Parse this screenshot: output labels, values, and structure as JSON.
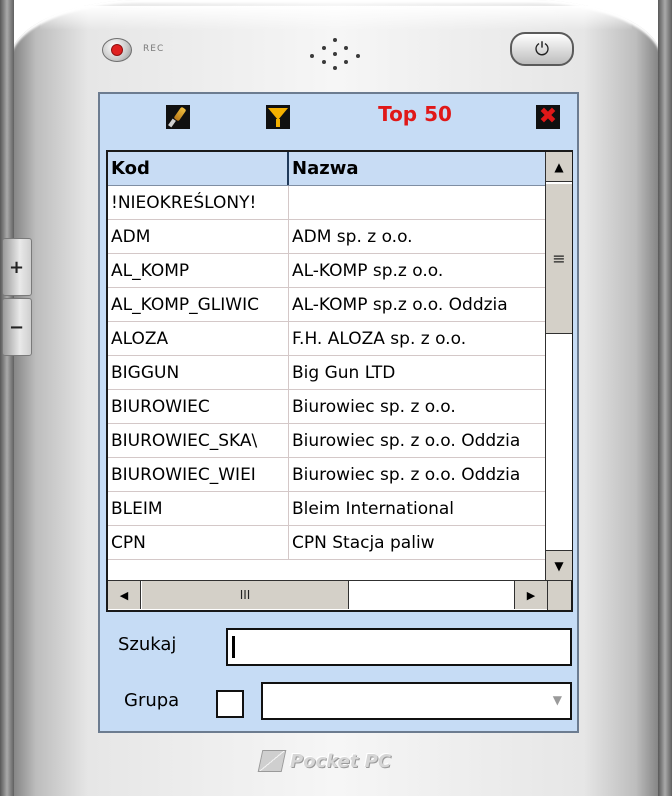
{
  "device": {
    "rec_label": "REC",
    "brand": "Pocket PC",
    "side_plus": "+",
    "side_minus": "−",
    "power_symbol": "⏻"
  },
  "toolbar": {
    "search_icon": "magnifier-icon",
    "filter_icon": "funnel-icon",
    "title": "Top 50",
    "close_icon": "close-icon",
    "close_glyph": "✖"
  },
  "grid": {
    "columns": [
      "Kod",
      "Nazwa"
    ],
    "rows": [
      [
        "!NIEOKREŚLONY!",
        ""
      ],
      [
        "ADM",
        "ADM sp. z o.o."
      ],
      [
        "AL_KOMP",
        "AL-KOMP sp.z o.o."
      ],
      [
        "AL_KOMP_GLIWIC",
        "AL-KOMP sp.z o.o. Oddzia"
      ],
      [
        "ALOZA",
        "F.H. ALOZA sp. z o.o."
      ],
      [
        "BIGGUN",
        "Big Gun LTD"
      ],
      [
        "BIUROWIEC",
        "Biurowiec sp. z o.o."
      ],
      [
        "BIUROWIEC_SKA\\",
        "Biurowiec sp. z o.o. Oddzia"
      ],
      [
        "BIUROWIEC_WIEI",
        "Biurowiec sp. z o.o. Oddzia"
      ],
      [
        "BLEIM",
        "Bleim International"
      ],
      [
        "CPN",
        "CPN Stacja paliw"
      ]
    ],
    "vscroll": {
      "up": "▲",
      "down": "▼",
      "thumb_grip": "≡"
    },
    "hscroll": {
      "left": "◀",
      "right": "▶",
      "thumb_grip": "III"
    }
  },
  "search": {
    "label": "Szukaj",
    "value": ""
  },
  "group": {
    "label": "Grupa",
    "checked": false,
    "selected": "",
    "chevron": "▼"
  },
  "colors": {
    "screen_bg": "#c6dcf5",
    "title_red": "#e01818",
    "grid_header_bg": "#c8dcf4"
  }
}
